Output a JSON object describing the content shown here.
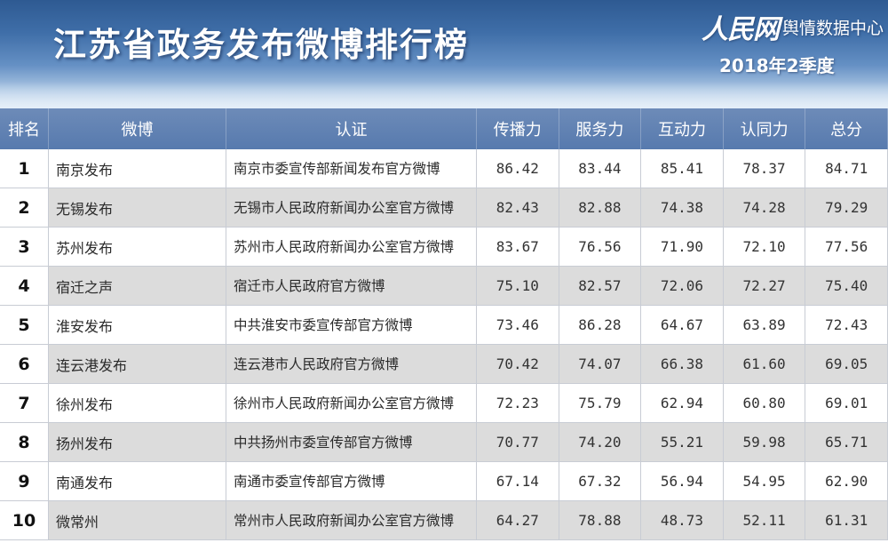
{
  "header": {
    "title": "江苏省政务发布微博排行榜",
    "brand_logo": "人民网",
    "brand_sub": "舆情数据中心",
    "period": "2018年2季度"
  },
  "table": {
    "columns": [
      "排名",
      "微博",
      "认证",
      "传播力",
      "服务力",
      "互动力",
      "认同力",
      "总分"
    ],
    "rows": [
      {
        "rank": "1",
        "weibo": "南京发布",
        "cert": "南京市委宣传部新闻发布官方微博",
        "c1": "86.42",
        "c2": "83.44",
        "c3": "85.41",
        "c4": "78.37",
        "total": "84.71"
      },
      {
        "rank": "2",
        "weibo": "无锡发布",
        "cert": "无锡市人民政府新闻办公室官方微博",
        "c1": "82.43",
        "c2": "82.88",
        "c3": "74.38",
        "c4": "74.28",
        "total": "79.29"
      },
      {
        "rank": "3",
        "weibo": "苏州发布",
        "cert": "苏州市人民政府新闻办公室官方微博",
        "c1": "83.67",
        "c2": "76.56",
        "c3": "71.90",
        "c4": "72.10",
        "total": "77.56"
      },
      {
        "rank": "4",
        "weibo": "宿迁之声",
        "cert": "宿迁市人民政府官方微博",
        "c1": "75.10",
        "c2": "82.57",
        "c3": "72.06",
        "c4": "72.27",
        "total": "75.40"
      },
      {
        "rank": "5",
        "weibo": "淮安发布",
        "cert": "中共淮安市委宣传部官方微博",
        "c1": "73.46",
        "c2": "86.28",
        "c3": "64.67",
        "c4": "63.89",
        "total": "72.43"
      },
      {
        "rank": "6",
        "weibo": "连云港发布",
        "cert": "连云港市人民政府官方微博",
        "c1": "70.42",
        "c2": "74.07",
        "c3": "66.38",
        "c4": "61.60",
        "total": "69.05"
      },
      {
        "rank": "7",
        "weibo": "徐州发布",
        "cert": "徐州市人民政府新闻办公室官方微博",
        "c1": "72.23",
        "c2": "75.79",
        "c3": "62.94",
        "c4": "60.80",
        "total": "69.01"
      },
      {
        "rank": "8",
        "weibo": "扬州发布",
        "cert": "中共扬州市委宣传部官方微博",
        "c1": "70.77",
        "c2": "74.20",
        "c3": "55.21",
        "c4": "59.98",
        "total": "65.71"
      },
      {
        "rank": "9",
        "weibo": "南通发布",
        "cert": "南通市委宣传部官方微博",
        "c1": "67.14",
        "c2": "67.32",
        "c3": "56.94",
        "c4": "54.95",
        "total": "62.90"
      },
      {
        "rank": "10",
        "weibo": "微常州",
        "cert": "常州市人民政府新闻办公室官方微博",
        "c1": "64.27",
        "c2": "78.88",
        "c3": "48.73",
        "c4": "52.11",
        "total": "61.31"
      }
    ]
  }
}
